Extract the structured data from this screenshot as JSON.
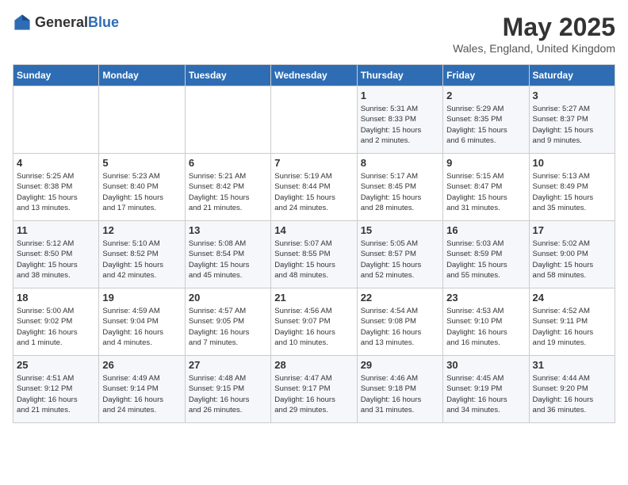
{
  "header": {
    "logo_general": "General",
    "logo_blue": "Blue",
    "title": "May 2025",
    "subtitle": "Wales, England, United Kingdom"
  },
  "days_of_week": [
    "Sunday",
    "Monday",
    "Tuesday",
    "Wednesday",
    "Thursday",
    "Friday",
    "Saturday"
  ],
  "weeks": [
    [
      {
        "day": "",
        "info": ""
      },
      {
        "day": "",
        "info": ""
      },
      {
        "day": "",
        "info": ""
      },
      {
        "day": "",
        "info": ""
      },
      {
        "day": "1",
        "info": "Sunrise: 5:31 AM\nSunset: 8:33 PM\nDaylight: 15 hours\nand 2 minutes."
      },
      {
        "day": "2",
        "info": "Sunrise: 5:29 AM\nSunset: 8:35 PM\nDaylight: 15 hours\nand 6 minutes."
      },
      {
        "day": "3",
        "info": "Sunrise: 5:27 AM\nSunset: 8:37 PM\nDaylight: 15 hours\nand 9 minutes."
      }
    ],
    [
      {
        "day": "4",
        "info": "Sunrise: 5:25 AM\nSunset: 8:38 PM\nDaylight: 15 hours\nand 13 minutes."
      },
      {
        "day": "5",
        "info": "Sunrise: 5:23 AM\nSunset: 8:40 PM\nDaylight: 15 hours\nand 17 minutes."
      },
      {
        "day": "6",
        "info": "Sunrise: 5:21 AM\nSunset: 8:42 PM\nDaylight: 15 hours\nand 21 minutes."
      },
      {
        "day": "7",
        "info": "Sunrise: 5:19 AM\nSunset: 8:44 PM\nDaylight: 15 hours\nand 24 minutes."
      },
      {
        "day": "8",
        "info": "Sunrise: 5:17 AM\nSunset: 8:45 PM\nDaylight: 15 hours\nand 28 minutes."
      },
      {
        "day": "9",
        "info": "Sunrise: 5:15 AM\nSunset: 8:47 PM\nDaylight: 15 hours\nand 31 minutes."
      },
      {
        "day": "10",
        "info": "Sunrise: 5:13 AM\nSunset: 8:49 PM\nDaylight: 15 hours\nand 35 minutes."
      }
    ],
    [
      {
        "day": "11",
        "info": "Sunrise: 5:12 AM\nSunset: 8:50 PM\nDaylight: 15 hours\nand 38 minutes."
      },
      {
        "day": "12",
        "info": "Sunrise: 5:10 AM\nSunset: 8:52 PM\nDaylight: 15 hours\nand 42 minutes."
      },
      {
        "day": "13",
        "info": "Sunrise: 5:08 AM\nSunset: 8:54 PM\nDaylight: 15 hours\nand 45 minutes."
      },
      {
        "day": "14",
        "info": "Sunrise: 5:07 AM\nSunset: 8:55 PM\nDaylight: 15 hours\nand 48 minutes."
      },
      {
        "day": "15",
        "info": "Sunrise: 5:05 AM\nSunset: 8:57 PM\nDaylight: 15 hours\nand 52 minutes."
      },
      {
        "day": "16",
        "info": "Sunrise: 5:03 AM\nSunset: 8:59 PM\nDaylight: 15 hours\nand 55 minutes."
      },
      {
        "day": "17",
        "info": "Sunrise: 5:02 AM\nSunset: 9:00 PM\nDaylight: 15 hours\nand 58 minutes."
      }
    ],
    [
      {
        "day": "18",
        "info": "Sunrise: 5:00 AM\nSunset: 9:02 PM\nDaylight: 16 hours\nand 1 minute."
      },
      {
        "day": "19",
        "info": "Sunrise: 4:59 AM\nSunset: 9:04 PM\nDaylight: 16 hours\nand 4 minutes."
      },
      {
        "day": "20",
        "info": "Sunrise: 4:57 AM\nSunset: 9:05 PM\nDaylight: 16 hours\nand 7 minutes."
      },
      {
        "day": "21",
        "info": "Sunrise: 4:56 AM\nSunset: 9:07 PM\nDaylight: 16 hours\nand 10 minutes."
      },
      {
        "day": "22",
        "info": "Sunrise: 4:54 AM\nSunset: 9:08 PM\nDaylight: 16 hours\nand 13 minutes."
      },
      {
        "day": "23",
        "info": "Sunrise: 4:53 AM\nSunset: 9:10 PM\nDaylight: 16 hours\nand 16 minutes."
      },
      {
        "day": "24",
        "info": "Sunrise: 4:52 AM\nSunset: 9:11 PM\nDaylight: 16 hours\nand 19 minutes."
      }
    ],
    [
      {
        "day": "25",
        "info": "Sunrise: 4:51 AM\nSunset: 9:12 PM\nDaylight: 16 hours\nand 21 minutes."
      },
      {
        "day": "26",
        "info": "Sunrise: 4:49 AM\nSunset: 9:14 PM\nDaylight: 16 hours\nand 24 minutes."
      },
      {
        "day": "27",
        "info": "Sunrise: 4:48 AM\nSunset: 9:15 PM\nDaylight: 16 hours\nand 26 minutes."
      },
      {
        "day": "28",
        "info": "Sunrise: 4:47 AM\nSunset: 9:17 PM\nDaylight: 16 hours\nand 29 minutes."
      },
      {
        "day": "29",
        "info": "Sunrise: 4:46 AM\nSunset: 9:18 PM\nDaylight: 16 hours\nand 31 minutes."
      },
      {
        "day": "30",
        "info": "Sunrise: 4:45 AM\nSunset: 9:19 PM\nDaylight: 16 hours\nand 34 minutes."
      },
      {
        "day": "31",
        "info": "Sunrise: 4:44 AM\nSunset: 9:20 PM\nDaylight: 16 hours\nand 36 minutes."
      }
    ]
  ]
}
